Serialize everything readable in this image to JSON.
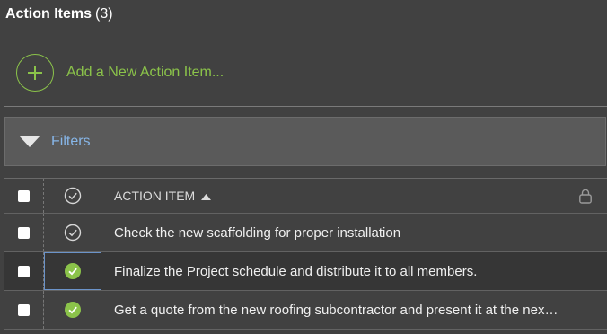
{
  "header": {
    "title": "Action Items",
    "count": "(3)"
  },
  "add_action": {
    "label": "Add a New Action Item..."
  },
  "filters": {
    "label": "Filters"
  },
  "table": {
    "column_label": "ACTION ITEM",
    "sort": "ascending",
    "rows": [
      {
        "text": "Check the new scaffolding for proper installation",
        "completed": false
      },
      {
        "text": "Finalize the Project schedule and distribute it to all members.",
        "completed": true
      },
      {
        "text": "Get a quote from the new roofing subcontractor and present it at the nex…",
        "completed": true
      }
    ]
  },
  "colors": {
    "accent_green": "#8bc34a",
    "link_blue": "#87b6e8",
    "background": "#414141",
    "focus_border": "#6b93c9"
  },
  "icons": {
    "add": "plus-circle-icon",
    "filters": "triangle-down-icon",
    "status_header": "check-circle-outline-icon",
    "sort": "sort-ascending-icon",
    "lock": "lock-icon"
  }
}
